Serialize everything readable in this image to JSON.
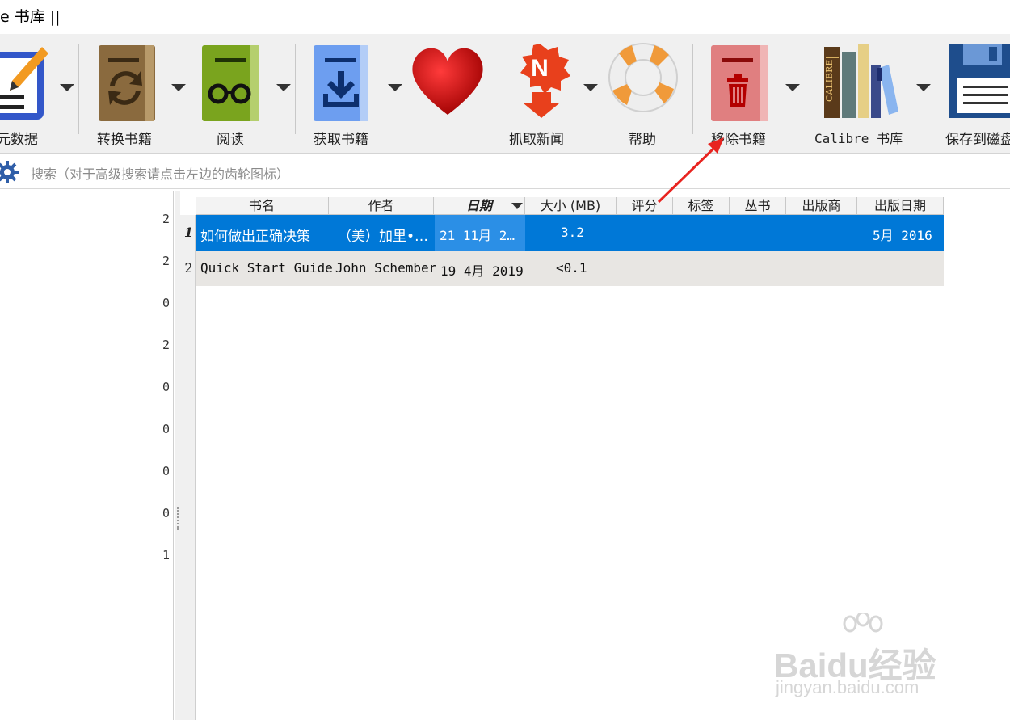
{
  "window": {
    "title": "e 书库 ||"
  },
  "toolbar": {
    "items": [
      {
        "label": "元数据",
        "icon": "edit-metadata-icon",
        "has_menu": true
      },
      {
        "label": "转换书籍",
        "icon": "convert-books-icon",
        "has_menu": true
      },
      {
        "label": "阅读",
        "icon": "read-book-icon",
        "has_menu": true
      },
      {
        "label": "获取书籍",
        "icon": "get-books-icon",
        "has_menu": true
      },
      {
        "label": "",
        "icon": "heart-donate-icon",
        "has_menu": false
      },
      {
        "label": "抓取新闻",
        "icon": "fetch-news-icon",
        "has_menu": true
      },
      {
        "label": "帮助",
        "icon": "lifebuoy-help-icon",
        "has_menu": false
      },
      {
        "label": "移除书籍",
        "icon": "remove-books-icon",
        "has_menu": true
      },
      {
        "label": "Calibre 书库",
        "icon": "calibre-library-icon",
        "has_menu": true
      },
      {
        "label": "保存到磁盘",
        "icon": "save-to-disk-icon",
        "has_menu": false
      }
    ]
  },
  "search": {
    "icon": "gear-icon",
    "placeholder": "搜索（对于高级搜索请点击左边的齿轮图标）"
  },
  "tag_browser": {
    "counts": [
      "2",
      "2",
      "0",
      "2",
      "0",
      "0",
      "0",
      "0",
      "1"
    ]
  },
  "book_list": {
    "columns": [
      "书名",
      "作者",
      "日期",
      "大小 (MB)",
      "评分",
      "标签",
      "丛书",
      "出版商",
      "出版日期"
    ],
    "sorted_column": "日期",
    "rows": [
      {
        "num": "1",
        "title": "如何做出正确决策",
        "author": "（美）加里•…",
        "date": "21 11月 2…",
        "size": "3.2",
        "pubdate": "5月 2016",
        "selected": true
      },
      {
        "num": "2",
        "title": "Quick Start Guide",
        "author": "John Schember",
        "date": "19 4月 2019",
        "size": "<0.1",
        "pubdate": "",
        "selected": false
      }
    ]
  },
  "colors": {
    "selection": "#0078d7",
    "annotation_arrow": "#e8231f"
  },
  "watermark": {
    "text": "Baidu经验",
    "sub": "jingyan.baidu.com"
  }
}
